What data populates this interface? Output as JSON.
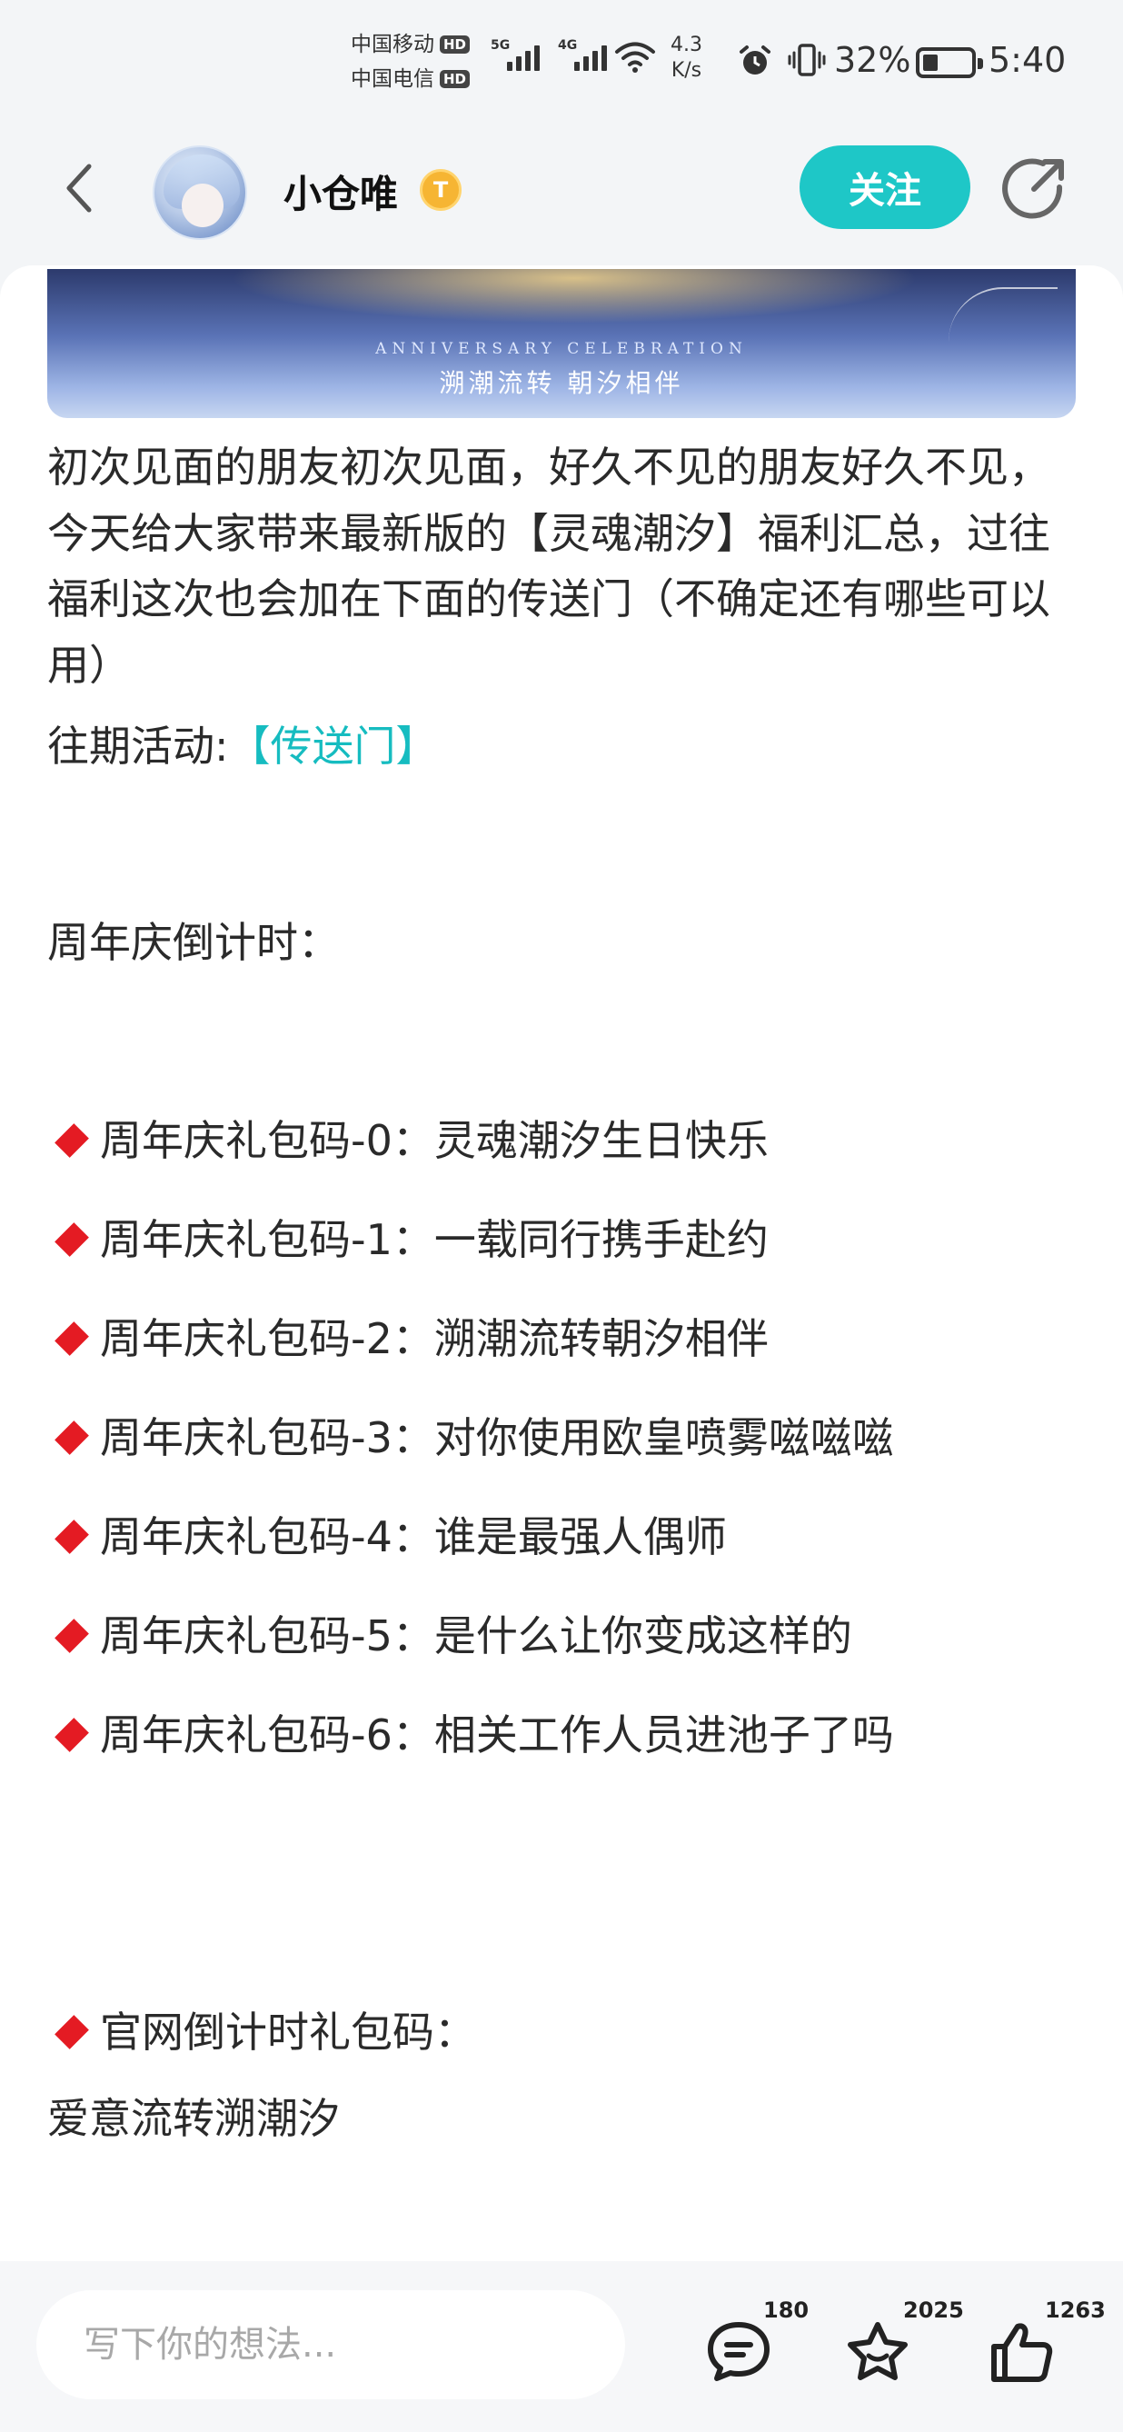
{
  "status_bar": {
    "carrier_1": "中国移动",
    "carrier_2": "中国电信",
    "hd_label": "HD",
    "gen_1": "5G",
    "gen_2": "4G",
    "net_speed_value": "4.3",
    "net_speed_unit": "K/s",
    "battery_percent": "32%",
    "battery_level": 0.32,
    "time": "5:40"
  },
  "header": {
    "username": "小仓唯",
    "badge_letter": "T",
    "follow_label": "关注"
  },
  "banner": {
    "subtitle_en": "ANNIVERSARY CELEBRATION",
    "subtitle_cn": "溯潮流转 朝汐相伴"
  },
  "article": {
    "intro": "初次见面的朋友初次见面，好久不见的朋友好久不见，今天给大家带来最新版的【灵魂潮汐】福利汇总，过往福利这次也会加在下面的传送门（不确定还有哪些可以用）",
    "past_events_label": "往期活动:",
    "past_events_link": "【传送门】",
    "countdown_heading": "周年庆倒计时：",
    "codes": [
      {
        "label": "周年庆礼包码-0：",
        "code": "灵魂潮汐生日快乐"
      },
      {
        "label": "周年庆礼包码-1：",
        "code": "一载同行携手赴约"
      },
      {
        "label": "周年庆礼包码-2：",
        "code": "溯潮流转朝汐相伴"
      },
      {
        "label": "周年庆礼包码-3：",
        "code": "对你使用欧皇喷雾嗞嗞嗞"
      },
      {
        "label": "周年庆礼包码-4：",
        "code": "谁是最强人偶师"
      },
      {
        "label": "周年庆礼包码-5：",
        "code": "是什么让你变成这样的"
      },
      {
        "label": "周年庆礼包码-6：",
        "code": "相关工作人员进池子了吗"
      }
    ],
    "official_heading": "官网倒计时礼包码：",
    "official_code": "爱意流转溯潮汐"
  },
  "bottom_bar": {
    "comment_placeholder": "写下你的想法...",
    "comment_count": "180",
    "favorite_count": "2025",
    "like_count": "1263"
  },
  "colors": {
    "accent": "#1ec7c7",
    "link": "#16bcc0",
    "diamond": "#e41b23",
    "badge": "#f6b533"
  }
}
